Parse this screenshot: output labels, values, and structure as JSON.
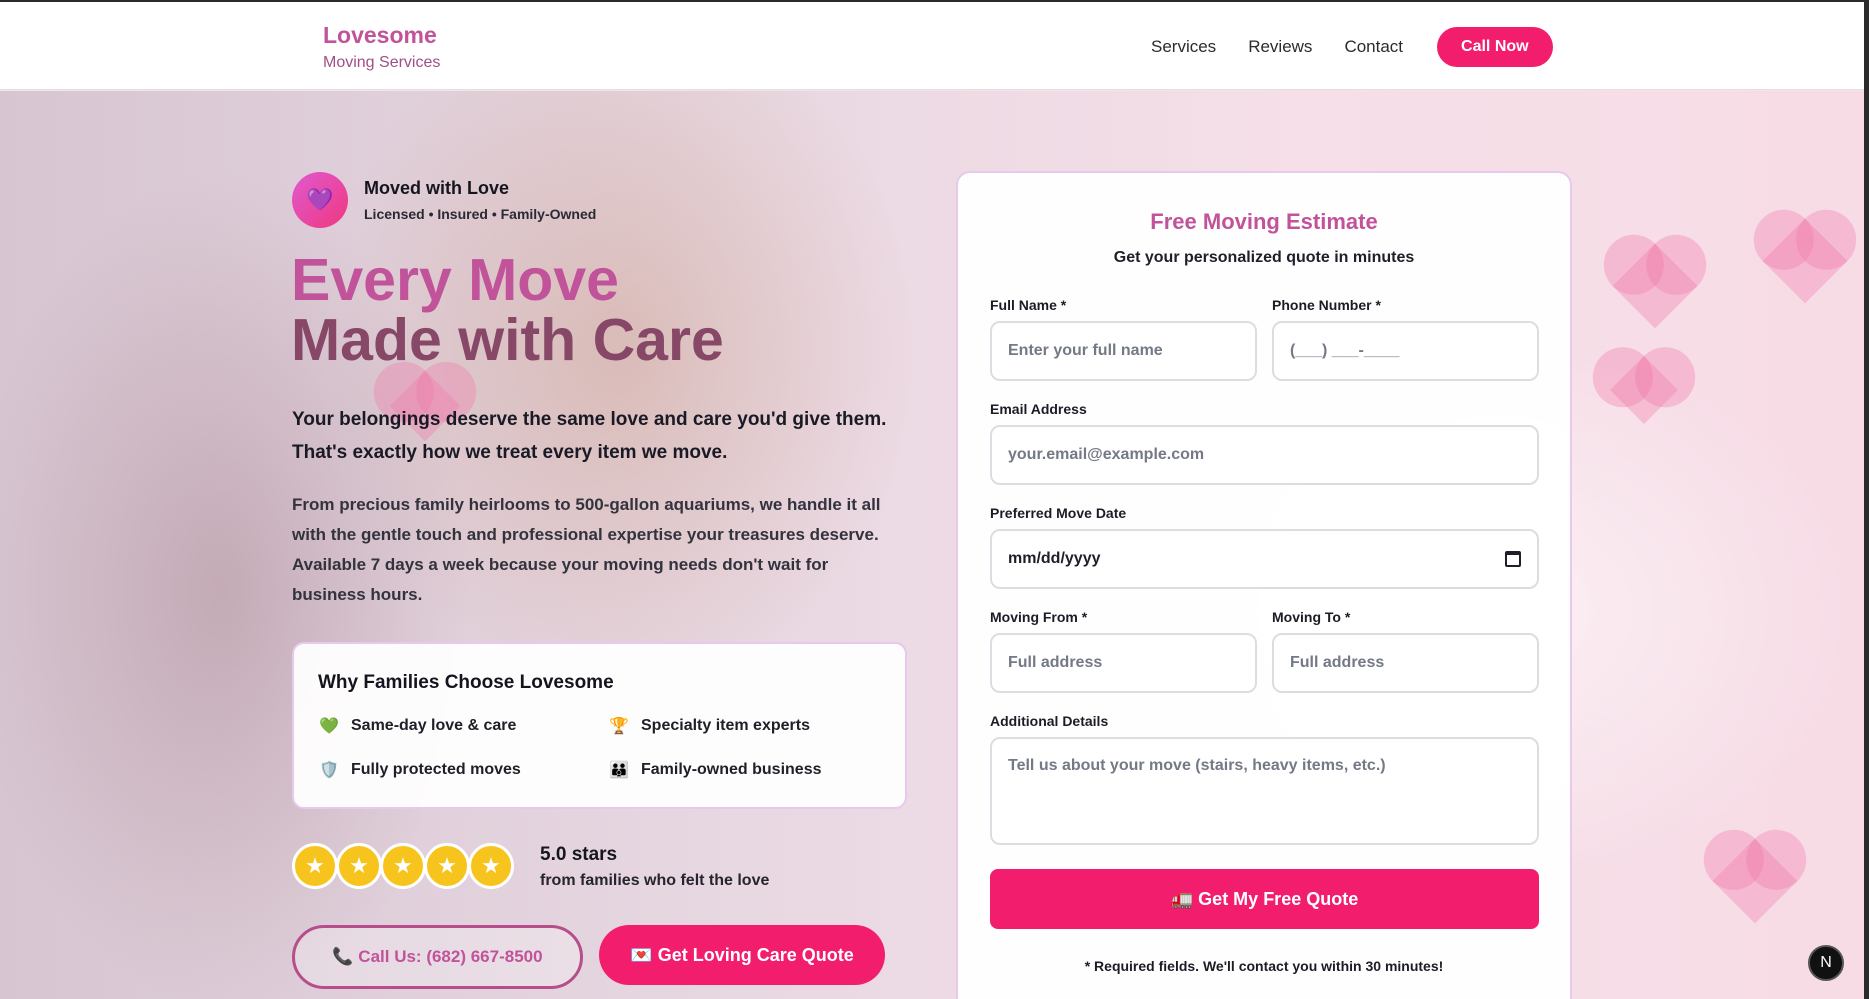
{
  "header": {
    "brand_name": "Lovesome",
    "brand_sub": "Moving Services",
    "nav": [
      "Services",
      "Reviews",
      "Contact"
    ],
    "call_label": "Call Now"
  },
  "hero": {
    "badge_icon": "heart-icon",
    "badge_title": "Moved with Love",
    "badge_sub": "Licensed • Insured • Family-Owned",
    "headline_1": "Every Move",
    "headline_2": "Made with Care",
    "lead": "Your belongings deserve the same love and care you'd give them. That's exactly how we treat every item we move.",
    "body": "From precious family heirlooms to 500-gallon aquariums, we handle it all with the gentle touch and professional expertise your treasures deserve. Available 7 days a week because your moving needs don't wait for business hours.",
    "why": {
      "title": "Why Families Choose Lovesome",
      "items": [
        {
          "icon": "green-heart-icon",
          "label": "Same-day love & care"
        },
        {
          "icon": "trophy-icon",
          "label": "Specialty item experts"
        },
        {
          "icon": "shield-icon",
          "label": "Fully protected moves"
        },
        {
          "icon": "family-icon",
          "label": "Family-owned business"
        }
      ]
    },
    "rating": {
      "stars": 5,
      "value": "5.0 stars",
      "sub": "from families who felt the love"
    },
    "call_us": "📞 Call Us: (682) 667-8500",
    "quote_btn": "💌 Get Loving Care Quote"
  },
  "form": {
    "title": "Free Moving Estimate",
    "subtitle": "Get your personalized quote in minutes",
    "full_name_label": "Full Name *",
    "full_name_placeholder": "Enter your full name",
    "phone_label": "Phone Number *",
    "phone_placeholder": "(___) ___-____",
    "email_label": "Email Address",
    "email_placeholder": "your.email@example.com",
    "date_label": "Preferred Move Date",
    "date_value": "mm/dd/yyyy",
    "from_label": "Moving From *",
    "from_placeholder": "Full address",
    "to_label": "Moving To *",
    "to_placeholder": "Full address",
    "details_label": "Additional Details",
    "details_placeholder": "Tell us about your move (stairs, heavy items, etc.)",
    "submit_label": "🚛 Get My Free Quote",
    "required_note": "* Required fields. We'll contact you within 30 minutes!"
  },
  "dev_badge": "N",
  "colors": {
    "accent": "#f21e6d",
    "brand": "#c1539a",
    "headline_dark": "#874766",
    "star": "#f7c41d"
  }
}
